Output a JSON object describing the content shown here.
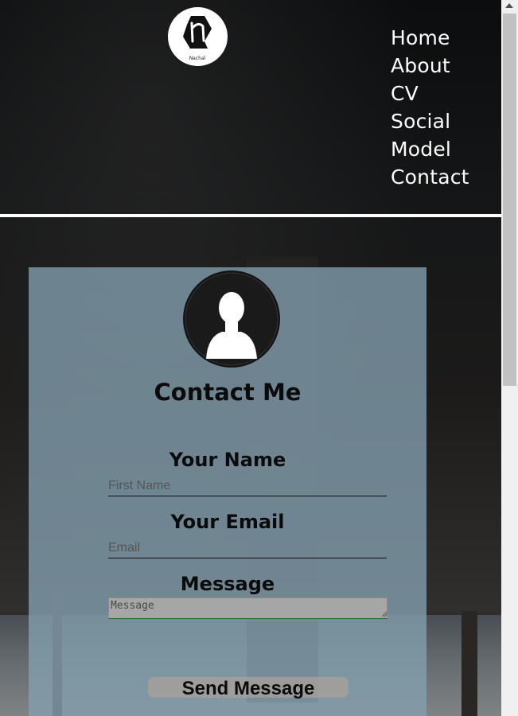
{
  "header": {
    "logo_name": "Nachal",
    "nav": [
      "Home",
      "About",
      "CV",
      "Social",
      "Model",
      "Contact"
    ]
  },
  "contact_form": {
    "title": "Contact Me",
    "name_label": "Your Name",
    "name_placeholder": "First Name",
    "email_label": "Your Email",
    "email_placeholder": "Email",
    "message_label": "Message",
    "message_placeholder": "Message",
    "send_label": "Send Message"
  },
  "colors": {
    "card": "#84a0af",
    "nav_text": "#ffffff",
    "background": "#111111"
  }
}
